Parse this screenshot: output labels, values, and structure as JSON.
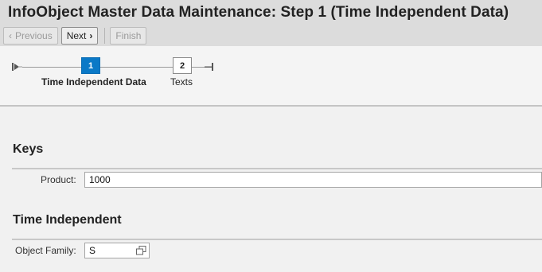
{
  "header": {
    "title": "InfoObject Master Data Maintenance: Step 1  (Time Independent Data)"
  },
  "toolbar": {
    "previous_label": "Previous",
    "next_label": "Next",
    "finish_label": "Finish"
  },
  "roadmap": {
    "steps": [
      {
        "number": "1",
        "label": "Time Independent Data",
        "active": true
      },
      {
        "number": "2",
        "label": "Texts",
        "active": false
      }
    ]
  },
  "sections": {
    "keys": {
      "title": "Keys",
      "product_label": "Product:",
      "product_value": "1000"
    },
    "time_independent": {
      "title": "Time Independent",
      "object_family_label": "Object Family:",
      "object_family_value": "S"
    }
  },
  "colors": {
    "active_step": "#0a79c7",
    "header_bg": "#dcdcdc",
    "page_bg": "#f1f1f1"
  },
  "icons": [
    "chevron-left-icon",
    "chevron-right-icon",
    "roadmap-start-icon",
    "roadmap-end-icon",
    "value-help-icon"
  ]
}
